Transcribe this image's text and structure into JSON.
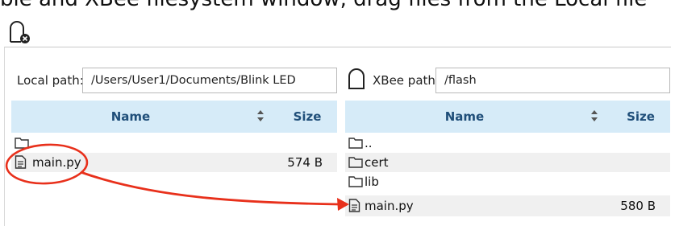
{
  "top_text": "ble and XBee filesystem window, drag files from the Local file",
  "local": {
    "label": "Local path:",
    "path": "/Users/User1/Documents/Blink LED",
    "columns": {
      "name": "Name",
      "size": "Size"
    },
    "rows": [
      {
        "icon": "folder-icon",
        "name": "",
        "size": ""
      },
      {
        "icon": "file-icon",
        "name": "main.py",
        "size": "574 B"
      }
    ]
  },
  "xbee": {
    "label": "XBee path:",
    "path": "/flash",
    "columns": {
      "name": "Name",
      "size": "Size"
    },
    "rows": [
      {
        "icon": "folder-icon",
        "name": "..",
        "size": ""
      },
      {
        "icon": "folder-icon",
        "name": "cert",
        "size": ""
      },
      {
        "icon": "folder-icon",
        "name": "lib",
        "size": ""
      },
      {
        "icon": "file-icon",
        "name": "main.py",
        "size": "580 B"
      }
    ]
  },
  "colors": {
    "header_bg": "#d6ebf8",
    "header_text": "#1f4e79",
    "annotation": "#e8301b"
  }
}
